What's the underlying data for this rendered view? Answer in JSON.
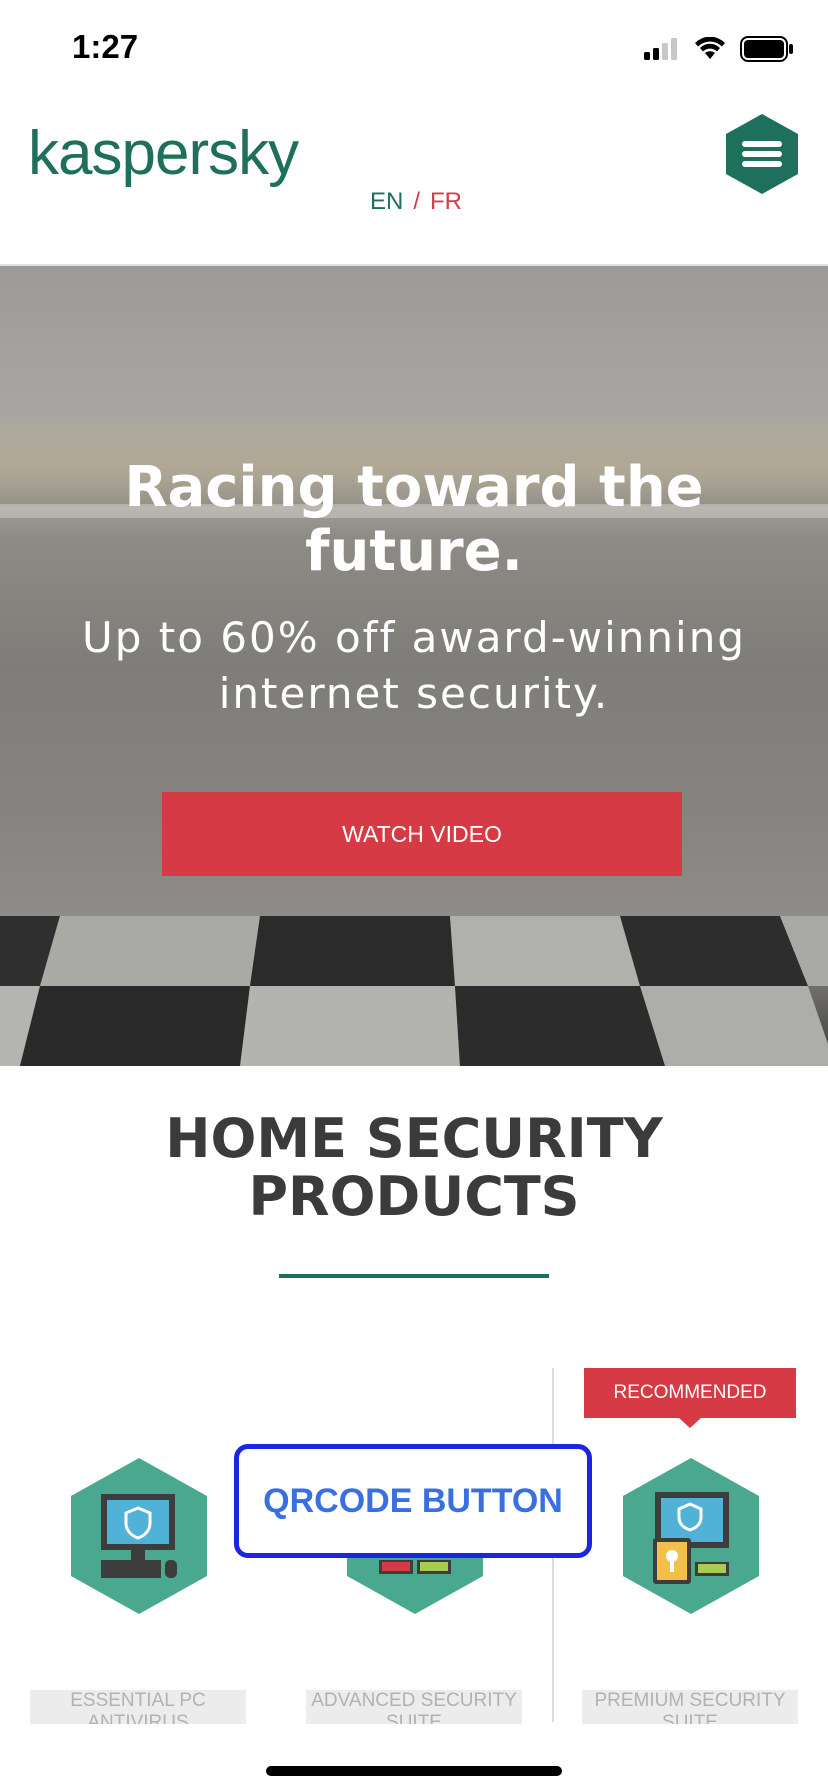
{
  "status_bar": {
    "time": "1:27"
  },
  "header": {
    "logo": "kaspersky",
    "lang_en": "EN",
    "lang_sep": "/",
    "lang_fr": "FR"
  },
  "hero": {
    "title_line1": "Racing toward the",
    "title_line2": "future.",
    "subtitle_line1": "Up to 60% off award-winning",
    "subtitle_line2": "internet security.",
    "cta_label": "WATCH VIDEO"
  },
  "section": {
    "title_line1": "HOME SECURITY",
    "title_line2": "PRODUCTS"
  },
  "products": [
    {
      "name": "ESSENTIAL PC ANTIVIRUS"
    },
    {
      "name": "ADVANCED SECURITY SUITE"
    },
    {
      "name": "PREMIUM SECURITY SUITE"
    }
  ],
  "badge": {
    "recommended": "RECOMMENDED"
  },
  "overlay": {
    "qr_label": "QRCODE BUTTON"
  },
  "colors": {
    "brand_green": "#1e6f5c",
    "accent_red": "#d63b45",
    "hex_green": "#49a88d",
    "overlay_blue": "#1b26e0"
  }
}
